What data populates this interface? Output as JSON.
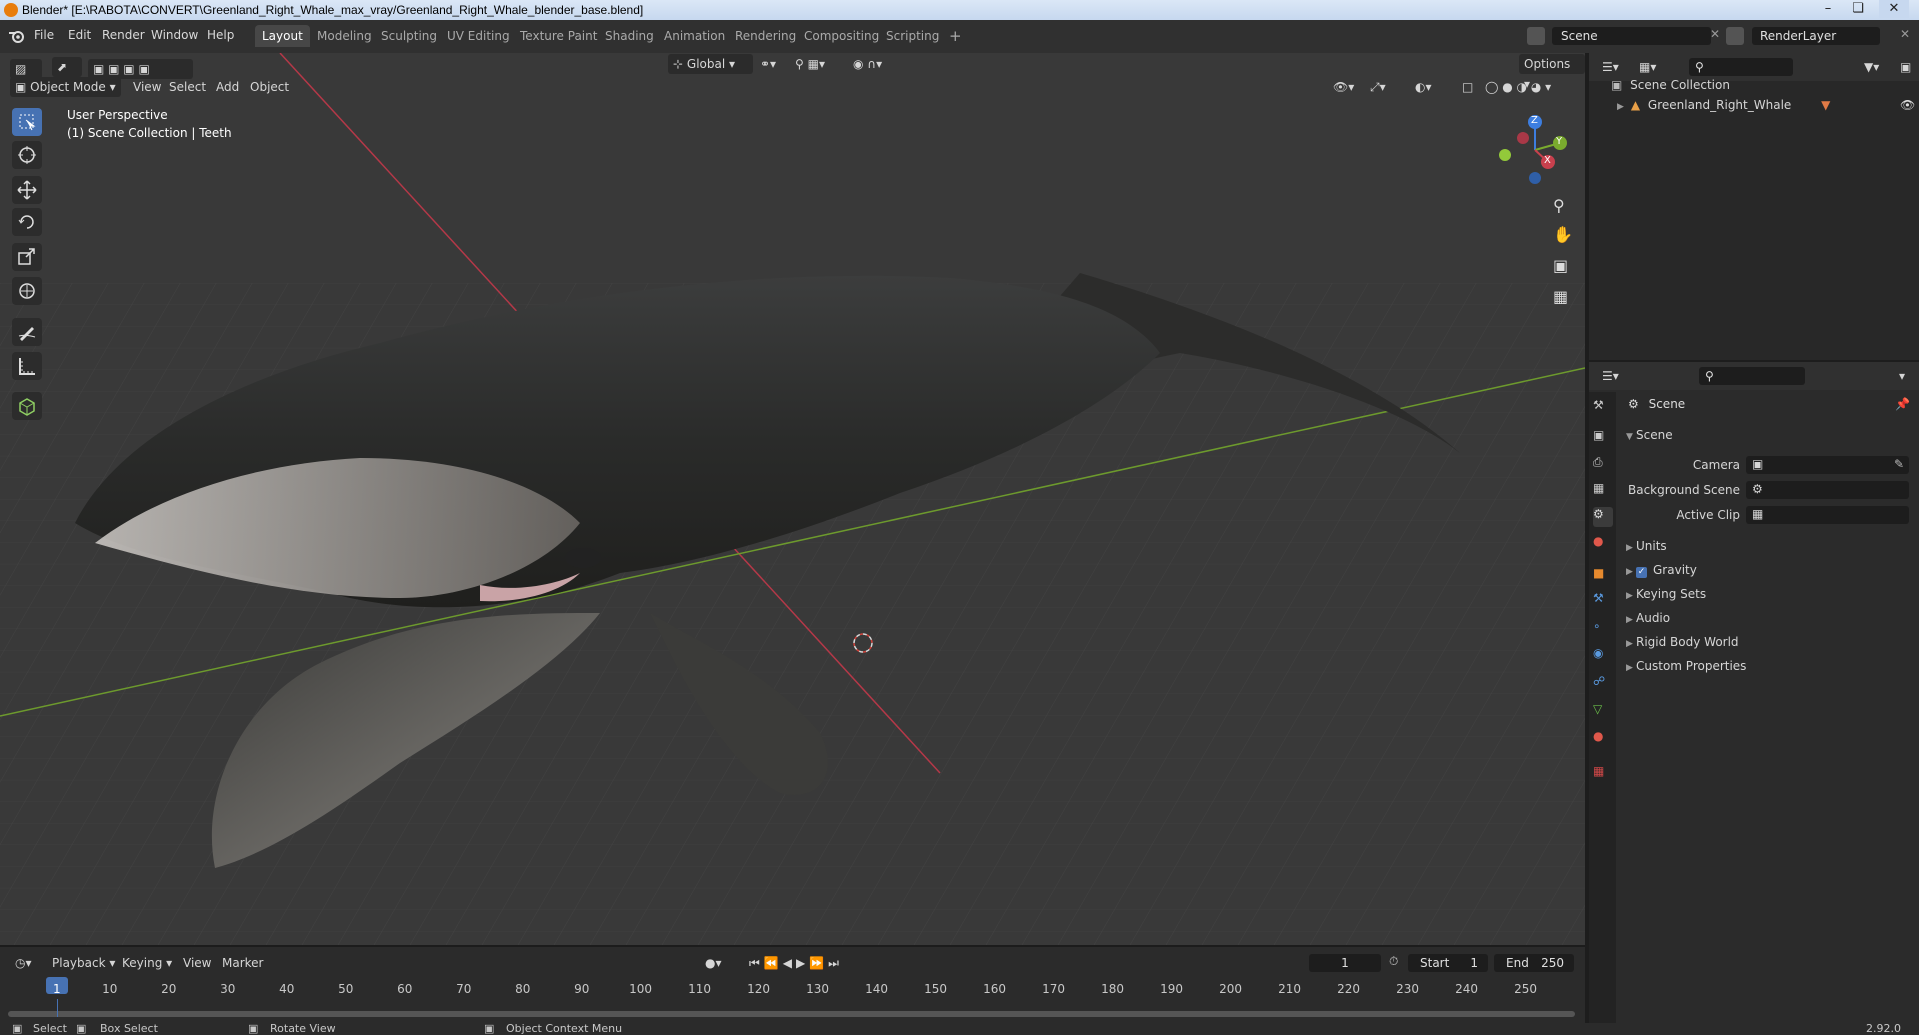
{
  "window": {
    "title": "Blender* [E:\\RABOTA\\CONVERT\\Greenland_Right_Whale_max_vray/Greenland_Right_Whale_blender_base.blend]"
  },
  "menu": {
    "file": "File",
    "edit": "Edit",
    "render": "Render",
    "window": "Window",
    "help": "Help"
  },
  "workspaces": [
    {
      "label": "Layout",
      "active": true
    },
    {
      "label": "Modeling"
    },
    {
      "label": "Sculpting"
    },
    {
      "label": "UV Editing"
    },
    {
      "label": "Texture Paint"
    },
    {
      "label": "Shading"
    },
    {
      "label": "Animation"
    },
    {
      "label": "Rendering"
    },
    {
      "label": "Compositing"
    },
    {
      "label": "Scripting"
    }
  ],
  "topright": {
    "scene": "Scene",
    "render_layer": "RenderLayer"
  },
  "viewport": {
    "transform_orientation": "Global",
    "options": "Options",
    "mode": "Object Mode",
    "menus": {
      "view": "View",
      "select": "Select",
      "add": "Add",
      "object": "Object"
    },
    "overlay_line1": "User Perspective",
    "overlay_line2": "(1) Scene Collection | Teeth",
    "gizmo": {
      "x": "X",
      "y": "Y",
      "z": "Z"
    }
  },
  "outliner": {
    "root": "Scene Collection",
    "items": [
      {
        "label": "Greenland_Right_Whale"
      }
    ]
  },
  "properties": {
    "context": "Scene",
    "panel_title": "Scene",
    "camera_label": "Camera",
    "background_scene_label": "Background Scene",
    "active_clip_label": "Active Clip",
    "panels": [
      "Units",
      "Gravity",
      "Keying Sets",
      "Audio",
      "Rigid Body World",
      "Custom Properties"
    ],
    "gravity_checked": true
  },
  "timeline": {
    "menus": {
      "playback": "Playback",
      "keying": "Keying",
      "view": "View",
      "marker": "Marker"
    },
    "current_frame": "1",
    "start_label": "Start",
    "start": "1",
    "end_label": "End",
    "end": "250",
    "ticks": [
      "1",
      "10",
      "20",
      "30",
      "40",
      "50",
      "60",
      "70",
      "80",
      "90",
      "100",
      "110",
      "120",
      "130",
      "140",
      "150",
      "160",
      "170",
      "180",
      "190",
      "200",
      "210",
      "220",
      "230",
      "240",
      "250"
    ]
  },
  "statusbar": {
    "select": "Select",
    "box_select": "Box Select",
    "rotate_view": "Rotate View",
    "context_menu": "Object Context Menu",
    "version": "2.92.0"
  },
  "colors": {
    "accent": "#4772b3",
    "axis_x": "#c8404d",
    "axis_y": "#7aab2e",
    "axis_z": "#3d7ee0"
  }
}
